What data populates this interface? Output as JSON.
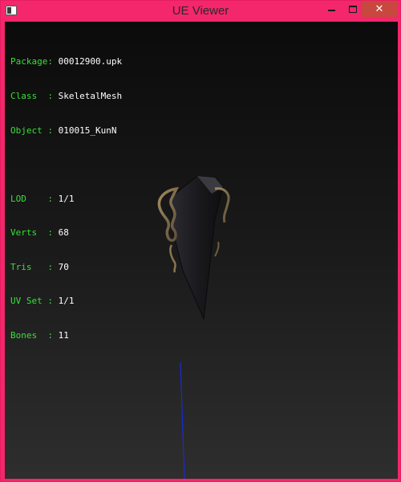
{
  "window": {
    "title": "UE Viewer",
    "close_glyph": "✕"
  },
  "info": {
    "package": {
      "label": "Package:",
      "value": "00012900.upk"
    },
    "class": {
      "label": "Class  :",
      "value": "SkeletalMesh"
    },
    "object": {
      "label": "Object :",
      "value": "010015_KunN"
    },
    "lod": {
      "label": "LOD    :",
      "value": "1/1"
    },
    "verts": {
      "label": "Verts  :",
      "value": "68"
    },
    "tris": {
      "label": "Tris   :",
      "value": "70"
    },
    "uvset": {
      "label": "UV Set :",
      "value": "1/1"
    },
    "bones": {
      "label": "Bones  :",
      "value": "11"
    }
  },
  "colors": {
    "frame": "#f4266c",
    "label_green": "#36e236",
    "value_white": "#ffffff",
    "axis_blue": "#1a2ad8",
    "mesh_dark": "#1e1e22",
    "trim_gold": "#8a7650"
  },
  "icons": [
    "app-icon",
    "minimize-icon",
    "maximize-icon",
    "close-icon"
  ]
}
